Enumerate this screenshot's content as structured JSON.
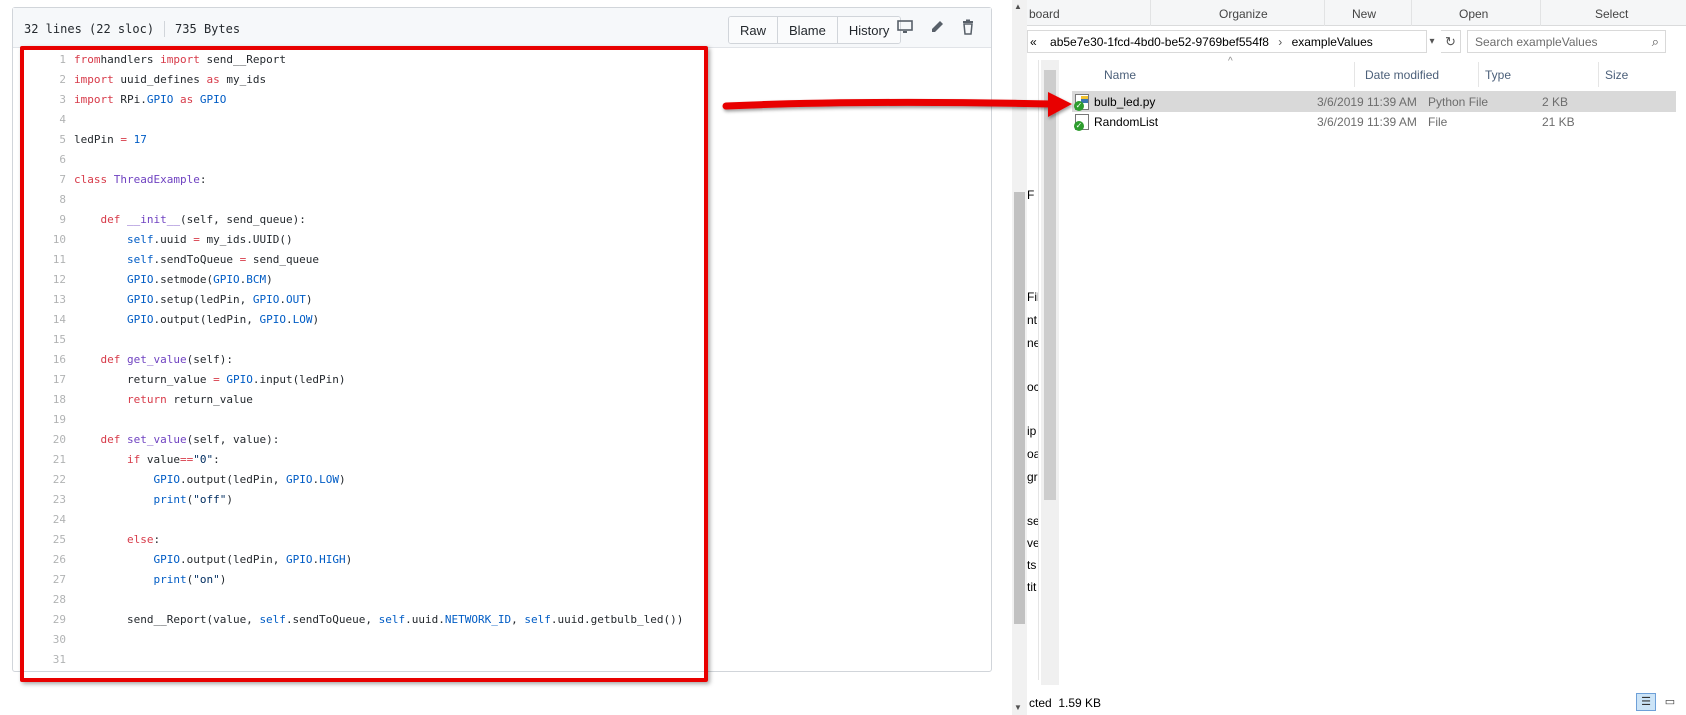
{
  "github": {
    "file_lines": "32 lines (22 sloc)",
    "file_size": "735 Bytes",
    "buttons": {
      "raw": "Raw",
      "blame": "Blame",
      "history": "History"
    },
    "code": [
      {
        "n": "1",
        "t": [
          [
            "k",
            "from"
          ],
          [
            "",
            "handlers "
          ],
          [
            "k",
            "import"
          ],
          [
            "",
            " send__Report"
          ]
        ]
      },
      {
        "n": "2",
        "t": [
          [
            "k",
            "import"
          ],
          [
            "",
            " uuid_defines "
          ],
          [
            "k",
            "as"
          ],
          [
            "",
            " my_ids"
          ]
        ]
      },
      {
        "n": "3",
        "t": [
          [
            "k",
            "import"
          ],
          [
            "",
            " RPi."
          ],
          [
            "c",
            "GPIO"
          ],
          [
            "",
            " "
          ],
          [
            "k",
            "as"
          ],
          [
            "",
            " "
          ],
          [
            "c",
            "GPIO"
          ]
        ]
      },
      {
        "n": "4",
        "t": []
      },
      {
        "n": "5",
        "t": [
          [
            "",
            "ledPin "
          ],
          [
            "k",
            "="
          ],
          [
            "",
            " "
          ],
          [
            "c",
            "17"
          ]
        ]
      },
      {
        "n": "6",
        "t": []
      },
      {
        "n": "7",
        "t": [
          [
            "k",
            "class"
          ],
          [
            "",
            " "
          ],
          [
            "f",
            "ThreadExample"
          ],
          [
            "",
            ":"
          ]
        ]
      },
      {
        "n": "8",
        "t": []
      },
      {
        "n": "9",
        "t": [
          [
            "",
            "    "
          ],
          [
            "k",
            "def"
          ],
          [
            "",
            " "
          ],
          [
            "f",
            "__init__"
          ],
          [
            "",
            "(self, send_queue):"
          ]
        ]
      },
      {
        "n": "10",
        "t": [
          [
            "",
            "        "
          ],
          [
            "c",
            "self"
          ],
          [
            "",
            ".uuid "
          ],
          [
            "k",
            "="
          ],
          [
            "",
            " my_ids.UUID()"
          ]
        ]
      },
      {
        "n": "11",
        "t": [
          [
            "",
            "        "
          ],
          [
            "c",
            "self"
          ],
          [
            "",
            ".sendToQueue "
          ],
          [
            "k",
            "="
          ],
          [
            "",
            " send_queue"
          ]
        ]
      },
      {
        "n": "12",
        "t": [
          [
            "",
            "        "
          ],
          [
            "c",
            "GPIO"
          ],
          [
            "",
            ".setmode("
          ],
          [
            "c",
            "GPIO"
          ],
          [
            "",
            "."
          ],
          [
            "c",
            "BCM"
          ],
          [
            "",
            ")"
          ]
        ]
      },
      {
        "n": "13",
        "t": [
          [
            "",
            "        "
          ],
          [
            "c",
            "GPIO"
          ],
          [
            "",
            ".setup(ledPin, "
          ],
          [
            "c",
            "GPIO"
          ],
          [
            "",
            "."
          ],
          [
            "c",
            "OUT"
          ],
          [
            "",
            ")"
          ]
        ]
      },
      {
        "n": "14",
        "t": [
          [
            "",
            "        "
          ],
          [
            "c",
            "GPIO"
          ],
          [
            "",
            ".output(ledPin, "
          ],
          [
            "c",
            "GPIO"
          ],
          [
            "",
            "."
          ],
          [
            "c",
            "LOW"
          ],
          [
            "",
            ")"
          ]
        ]
      },
      {
        "n": "15",
        "t": []
      },
      {
        "n": "16",
        "t": [
          [
            "",
            "    "
          ],
          [
            "k",
            "def"
          ],
          [
            "",
            " "
          ],
          [
            "f",
            "get_value"
          ],
          [
            "",
            "(self):"
          ]
        ]
      },
      {
        "n": "17",
        "t": [
          [
            "",
            "        return_value "
          ],
          [
            "k",
            "="
          ],
          [
            "",
            " "
          ],
          [
            "c",
            "GPIO"
          ],
          [
            "",
            ".input(ledPin)"
          ]
        ]
      },
      {
        "n": "18",
        "t": [
          [
            "",
            "        "
          ],
          [
            "k",
            "return"
          ],
          [
            "",
            " return_value"
          ]
        ]
      },
      {
        "n": "19",
        "t": []
      },
      {
        "n": "20",
        "t": [
          [
            "",
            "    "
          ],
          [
            "k",
            "def"
          ],
          [
            "",
            " "
          ],
          [
            "f",
            "set_value"
          ],
          [
            "",
            "(self, value):"
          ]
        ]
      },
      {
        "n": "21",
        "t": [
          [
            "",
            "        "
          ],
          [
            "k",
            "if"
          ],
          [
            "",
            " value"
          ],
          [
            "k",
            "=="
          ],
          [
            "s",
            "\"0\""
          ],
          [
            "",
            ":"
          ]
        ]
      },
      {
        "n": "22",
        "t": [
          [
            "",
            "            "
          ],
          [
            "c",
            "GPIO"
          ],
          [
            "",
            ".output(ledPin, "
          ],
          [
            "c",
            "GPIO"
          ],
          [
            "",
            "."
          ],
          [
            "c",
            "LOW"
          ],
          [
            "",
            ")"
          ]
        ]
      },
      {
        "n": "23",
        "t": [
          [
            "",
            "            "
          ],
          [
            "c",
            "print"
          ],
          [
            "",
            "("
          ],
          [
            "s",
            "\"off\""
          ],
          [
            "",
            ")"
          ]
        ]
      },
      {
        "n": "24",
        "t": []
      },
      {
        "n": "25",
        "t": [
          [
            "",
            "        "
          ],
          [
            "k",
            "else"
          ],
          [
            "",
            ":"
          ]
        ]
      },
      {
        "n": "26",
        "t": [
          [
            "",
            "            "
          ],
          [
            "c",
            "GPIO"
          ],
          [
            "",
            ".output(ledPin, "
          ],
          [
            "c",
            "GPIO"
          ],
          [
            "",
            "."
          ],
          [
            "c",
            "HIGH"
          ],
          [
            "",
            ")"
          ]
        ]
      },
      {
        "n": "27",
        "t": [
          [
            "",
            "            "
          ],
          [
            "c",
            "print"
          ],
          [
            "",
            "("
          ],
          [
            "s",
            "\"on\""
          ],
          [
            "",
            ")"
          ]
        ]
      },
      {
        "n": "28",
        "t": []
      },
      {
        "n": "29",
        "t": [
          [
            "",
            "        send__Report(value, "
          ],
          [
            "c",
            "self"
          ],
          [
            "",
            ".sendToQueue, "
          ],
          [
            "c",
            "self"
          ],
          [
            "",
            ".uuid."
          ],
          [
            "c",
            "NETWORK_ID"
          ],
          [
            "",
            ", "
          ],
          [
            "c",
            "self"
          ],
          [
            "",
            ".uuid.getbulb_led())"
          ]
        ]
      },
      {
        "n": "30",
        "t": []
      },
      {
        "n": "31",
        "t": []
      }
    ]
  },
  "explorer": {
    "ribbon": {
      "left_cut": "board",
      "organize": "Organize",
      "new": "New",
      "open": "Open",
      "select": "Select"
    },
    "address": {
      "prefix": "«",
      "folder": "ab5e7e30-1fcd-4bd0-be52-9769bef554f8",
      "subfolder": "exampleValues"
    },
    "search_placeholder": "Search exampleValues",
    "nav_fragments": [
      "F",
      "Fil",
      "nt",
      "ne",
      "oc",
      "ip",
      "oa",
      "gr",
      "se",
      "ve",
      "ts",
      "tit"
    ],
    "columns": {
      "name": "Name",
      "date": "Date modified",
      "type": "Type",
      "size": "Size"
    },
    "files": [
      {
        "name": "bulb_led.py",
        "date": "3/6/2019 11:39 AM",
        "type": "Python File",
        "size": "2 KB",
        "selected": true
      },
      {
        "name": "RandomList",
        "date": "3/6/2019 11:39 AM",
        "type": "File",
        "size": "21 KB",
        "selected": false
      }
    ],
    "status": {
      "selected_cut": "cted",
      "size": "1.59 KB"
    }
  },
  "colors": {
    "highlight": "#e80000",
    "arrow": "#e80000"
  }
}
